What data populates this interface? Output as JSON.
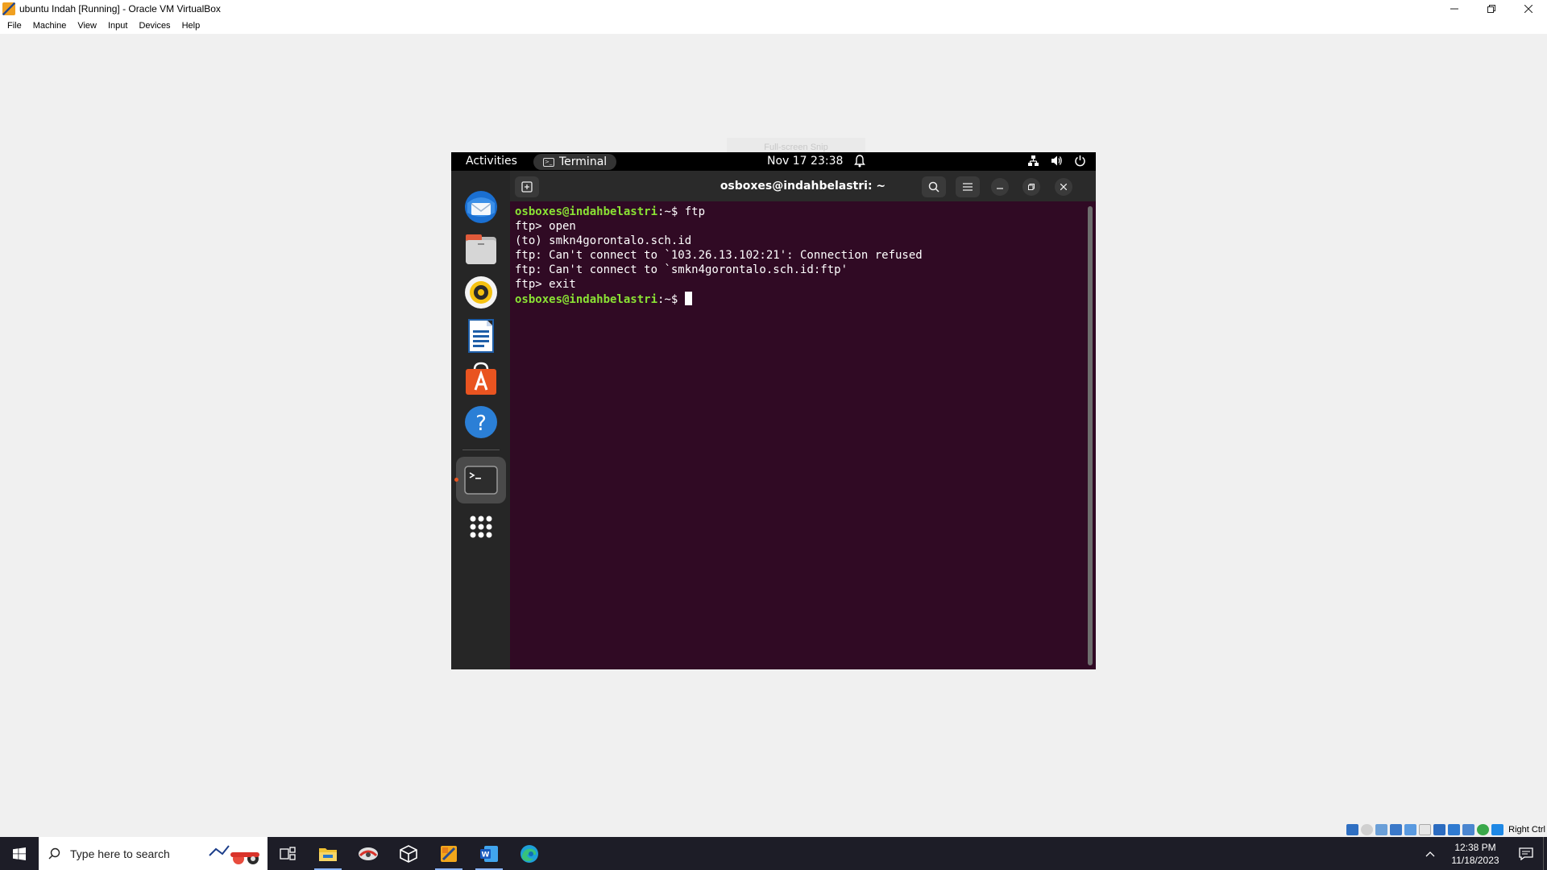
{
  "host_window": {
    "title": "ubuntu Indah [Running] - Oracle VM VirtualBox",
    "controls": [
      "minimize",
      "restore",
      "close"
    ]
  },
  "host_menu": [
    "File",
    "Machine",
    "View",
    "Input",
    "Devices",
    "Help"
  ],
  "snip_tooltip": "Full-screen Snip",
  "guest": {
    "topbar": {
      "activities": "Activities",
      "app_name": "Terminal",
      "clock": "Nov 17  23:38"
    },
    "dock": [
      "thunderbird-icon",
      "files-icon",
      "rhythmbox-icon",
      "writer-icon",
      "software-icon",
      "help-icon",
      "terminal-icon",
      "app-grid-icon"
    ],
    "terminal": {
      "title": "osboxes@indahbelastri: ~",
      "prompt_user": "osboxes@indahbelastri",
      "prompt_sep": ":~$ ",
      "line1_cmd": "ftp",
      "line2": "ftp> open",
      "line3": "(to) smkn4gorontalo.sch.id",
      "line4": "ftp: Can't connect to `103.26.13.102:21': Connection refused",
      "line5": "ftp: Can't connect to `smkn4gorontalo.sch.id:ftp'",
      "line6": "ftp> exit"
    }
  },
  "vbox_status": {
    "host_key": "Right Ctrl"
  },
  "taskbar": {
    "search_placeholder": "Type here to search",
    "apps": [
      "task-view",
      "file-explorer",
      "snipping-app",
      "virtualbox-cube",
      "virtualbox",
      "word",
      "edge"
    ],
    "time": "12:38 PM",
    "date": "11/18/2023"
  },
  "colors": {
    "terminal_bg": "#300a24",
    "prompt_green": "#8ae234",
    "ubuntu_orange": "#e95420",
    "taskbar_bg": "#1d1d27"
  }
}
